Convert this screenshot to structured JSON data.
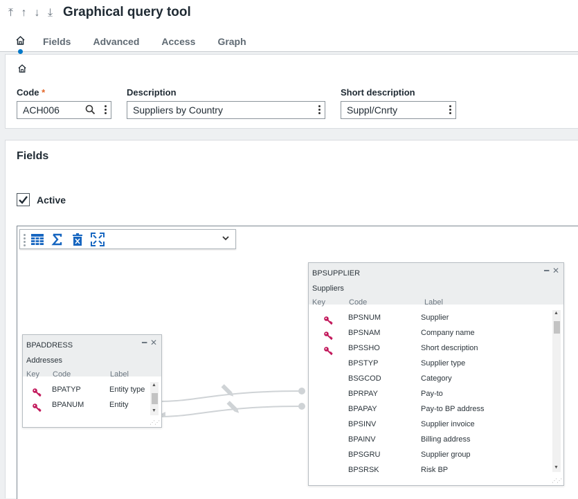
{
  "header": {
    "title": "Graphical query tool"
  },
  "tabs": [
    {
      "label": "Fields"
    },
    {
      "label": "Advanced"
    },
    {
      "label": "Access"
    },
    {
      "label": "Graph"
    }
  ],
  "form": {
    "code_label": "Code",
    "code_required": "*",
    "code_value": "ACH006",
    "description_label": "Description",
    "description_value": "Suppliers by Country",
    "short_label": "Short description",
    "short_value": "Suppl/Cnrty"
  },
  "fields_section": {
    "title": "Fields",
    "active_label": "Active",
    "active_checked": true
  },
  "columns": {
    "key": "Key",
    "code": "Code",
    "label": "Label"
  },
  "bpaddress": {
    "name": "BPADDRESS",
    "description": "Addresses",
    "rows": [
      {
        "key": true,
        "code": "BPATYP",
        "label": "Entity type"
      },
      {
        "key": true,
        "code": "BPANUM",
        "label": "Entity"
      }
    ]
  },
  "bpsupplier": {
    "name": "BPSUPPLIER",
    "description": "Suppliers",
    "rows": [
      {
        "key": true,
        "code": "BPSNUM",
        "label": "Supplier"
      },
      {
        "key": true,
        "code": "BPSNAM",
        "label": "Company name"
      },
      {
        "key": true,
        "code": "BPSSHO",
        "label": "Short description"
      },
      {
        "key": false,
        "code": "BPSTYP",
        "label": "Supplier type"
      },
      {
        "key": false,
        "code": "BSGCOD",
        "label": "Category"
      },
      {
        "key": false,
        "code": "BPRPAY",
        "label": "Pay-to"
      },
      {
        "key": false,
        "code": "BPAPAY",
        "label": "Pay-to BP address"
      },
      {
        "key": false,
        "code": "BPSINV",
        "label": "Supplier invoice"
      },
      {
        "key": false,
        "code": "BPAINV",
        "label": "Billing address"
      },
      {
        "key": false,
        "code": "BPSGRU",
        "label": "Supplier group"
      },
      {
        "key": false,
        "code": "BPSRSK",
        "label": "Risk BP"
      }
    ]
  },
  "colors": {
    "accent": "#0078c8",
    "required": "#e3672a",
    "key_icon": "#c2185b",
    "toolbar_icon": "#1565c0"
  }
}
